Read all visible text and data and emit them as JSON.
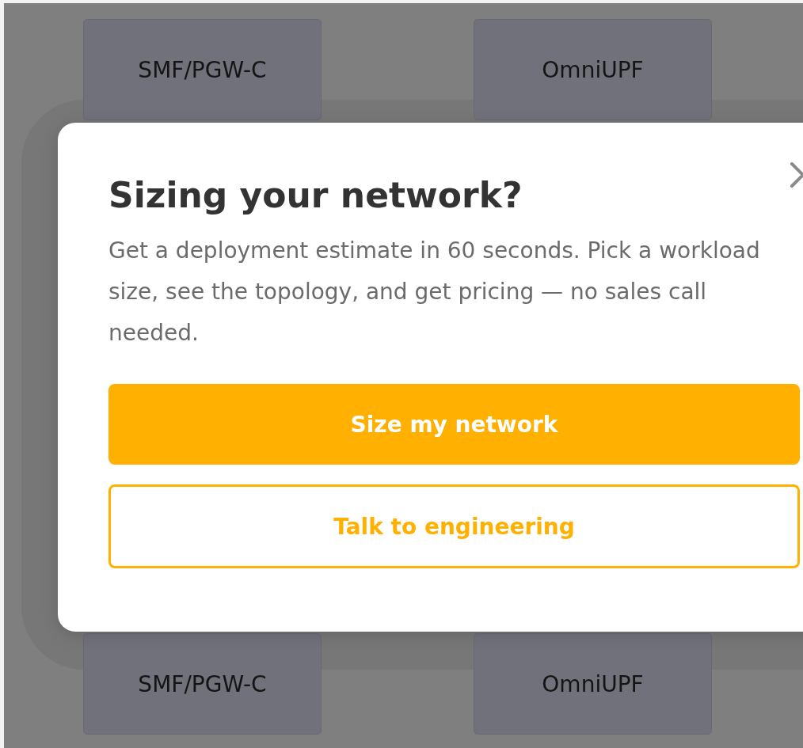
{
  "diagram": {
    "top_nodes": [
      {
        "label": "SMF/PGW-C"
      },
      {
        "label": "OmniUPF"
      }
    ],
    "bottom_nodes": [
      {
        "label": "SMF/PGW-C"
      },
      {
        "label": "OmniUPF"
      }
    ]
  },
  "dialog": {
    "title": "Sizing your network?",
    "body": "Get a deployment estimate in 60 seconds. Pick a workload size, see the topology, and get pricing — no sales call needed.",
    "buttons": [
      {
        "label": "Size my network",
        "kind": "primary"
      },
      {
        "label": "Talk to engineering",
        "kind": "secondary"
      }
    ]
  }
}
